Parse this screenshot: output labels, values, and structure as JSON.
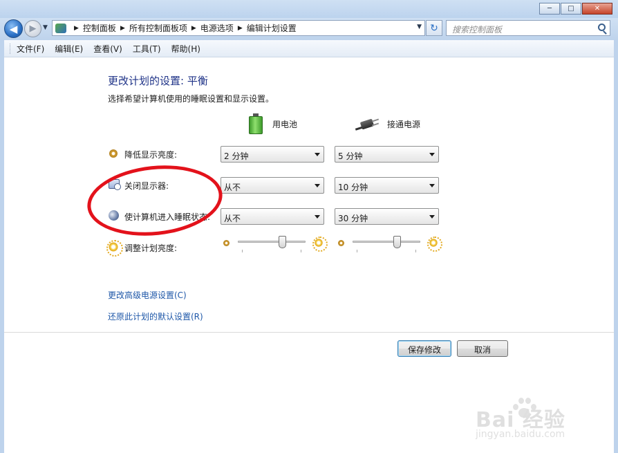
{
  "window": {
    "buttons": {
      "minimize": "─",
      "maximize": "□",
      "close": "✕"
    }
  },
  "nav": {
    "back_icon": "back-arrow-icon",
    "forward_icon": "forward-arrow-icon",
    "breadcrumbs": [
      "控制面板",
      "所有控制面板项",
      "电源选项",
      "编辑计划设置"
    ],
    "search_placeholder": "搜索控制面板"
  },
  "menu": {
    "items": [
      "文件(F)",
      "编辑(E)",
      "查看(V)",
      "工具(T)",
      "帮助(H)"
    ]
  },
  "main": {
    "title": "更改计划的设置: 平衡",
    "subtitle": "选择希望计算机使用的睡眠设置和显示设置。",
    "columns": {
      "battery": "用电池",
      "plugged_in": "接通电源"
    },
    "rows": [
      {
        "label": "降低显示亮度:",
        "icon": "dim-brightness-icon",
        "battery": "2 分钟",
        "plugged_in": "5 分钟"
      },
      {
        "label": "关闭显示器:",
        "icon": "monitor-clock-icon",
        "battery": "从不",
        "plugged_in": "10 分钟"
      },
      {
        "label": "使计算机进入睡眠状态:",
        "icon": "moon-sleep-icon",
        "battery": "从不",
        "plugged_in": "30 分钟"
      }
    ],
    "brightness": {
      "label": "调整计划亮度:",
      "battery_level": 0.68,
      "plugged_in_level": 0.68
    },
    "links": {
      "advanced": "更改高级电源设置(C)",
      "restore": "还原此计划的默认设置(R)"
    },
    "buttons": {
      "save": "保存修改",
      "cancel": "取消"
    }
  },
  "watermark": {
    "logo": "Bai 经验",
    "url": "jingyan.baidu.com"
  },
  "colors": {
    "title": "#1e3287",
    "link": "#1e57a8",
    "annotation": "#e3121b",
    "chrome": "#bed3ec"
  }
}
